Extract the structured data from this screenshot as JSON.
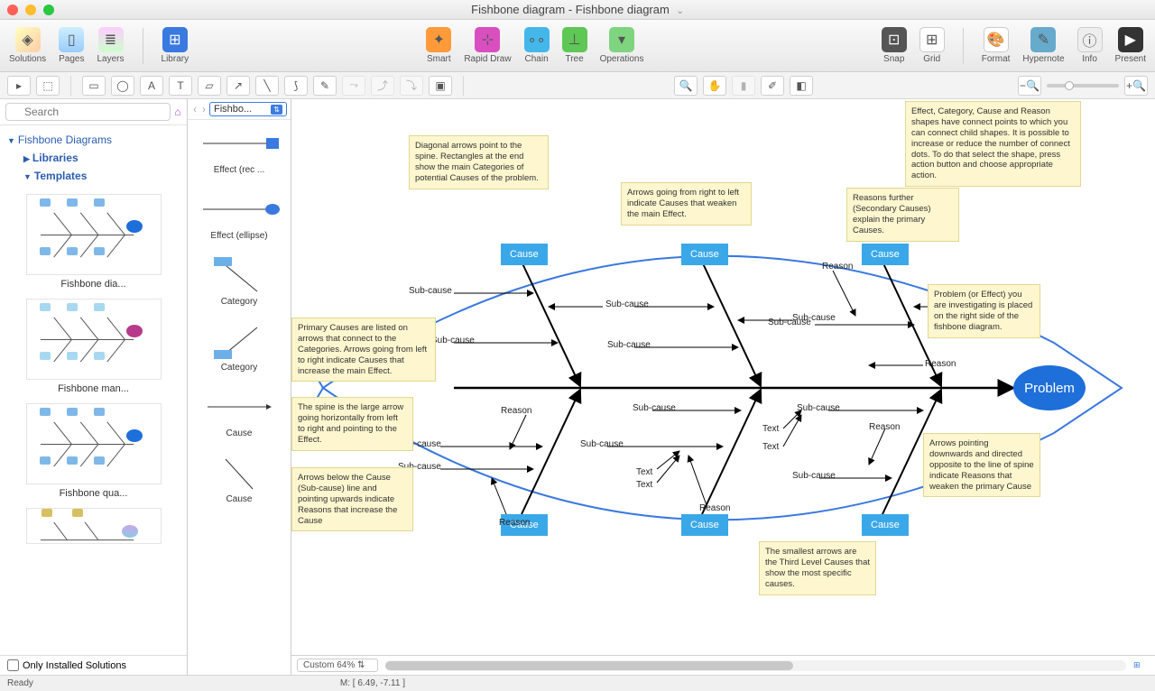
{
  "window": {
    "title": "Fishbone diagram - Fishbone diagram"
  },
  "toolbar": {
    "solutions": "Solutions",
    "pages": "Pages",
    "layers": "Layers",
    "library": "Library",
    "smart": "Smart",
    "rapid": "Rapid Draw",
    "chain": "Chain",
    "tree": "Tree",
    "operations": "Operations",
    "snap": "Snap",
    "grid": "Grid",
    "format": "Format",
    "hypernote": "Hypernote",
    "info": "Info",
    "present": "Present"
  },
  "search": {
    "placeholder": "Search"
  },
  "tree": {
    "root": "Fishbone Diagrams",
    "libraries": "Libraries",
    "templates": "Templates"
  },
  "thumbs": [
    "Fishbone dia...",
    "Fishbone man...",
    "Fishbone qua..."
  ],
  "only_installed": "Only Installed Solutions",
  "shapes": {
    "selector": "Fishbo...",
    "items": [
      "Effect (rec ...",
      "Effect (ellipse)",
      "Category",
      "Category",
      "Cause",
      "Cause"
    ]
  },
  "diagram": {
    "problem": "Problem",
    "cause": "Cause",
    "subcause": "Sub-cause",
    "reason": "Reason",
    "text": "Text",
    "notes": {
      "n1": "Diagonal arrows point to the spine. Rectangles at the end show the main Categories of potential Causes of the problem.",
      "n2": "Arrows going from right to left indicate Causes that weaken the main Effect.",
      "n3": "Reasons further (Secondary Causes) explain the primary Causes.",
      "n4": "Effect, Category, Cause and Reason shapes have connect points to which you can connect child shapes. It is possible to increase or reduce the number of connect dots. To do that select the shape, press action button and choose appropriate action.",
      "n5": "Problem (or Effect) you are investigating is placed on the right side of the fishbone diagram.",
      "n6": "Primary Causes are listed on arrows that connect to the Categories. Arrows going from left to right indicate Causes that increase the main Effect.",
      "n7": "The spine is the large arrow going horizontally from left to right and pointing to the Effect.",
      "n8": "Arrows below the Cause (Sub-cause) line and pointing upwards indicate Reasons that increase the Cause",
      "n9": "Arrows pointing downwards and directed opposite to the line of spine indicate Reasons that weaken the primary Cause",
      "n10": "The smallest arrows are the Third Level Causes that show the most specific causes."
    }
  },
  "footer": {
    "zoom": "Custom 64%",
    "ready": "Ready",
    "mouse": "M: [ 6.49, -7.11 ]"
  }
}
